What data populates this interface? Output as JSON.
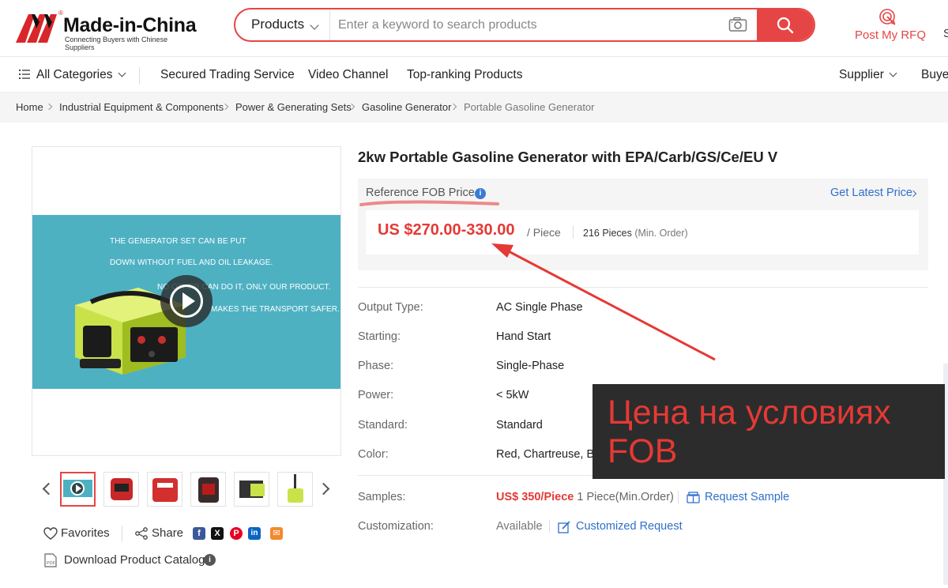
{
  "header": {
    "logo_name": "Made-in-China",
    "logo_registered": "®",
    "logo_tagline": "Connecting Buyers with Chinese Suppliers",
    "search_category": "Products",
    "search_placeholder": "Enter a keyword to search products",
    "rfq_label": "Post My RFQ",
    "cut_text": "S"
  },
  "nav": {
    "all_categories": "All Categories",
    "items": [
      "Secured Trading Service",
      "Video Channel",
      "Top-ranking Products"
    ],
    "supplier": "Supplier",
    "buyer": "Buyer"
  },
  "breadcrumb": [
    "Home",
    "Industrial Equipment & Components",
    "Power & Generating Sets",
    "Gasoline Generator",
    "Portable Gasoline Generator"
  ],
  "hero_text": [
    "THE GENERATOR SET CAN BE PUT",
    "DOWN WITHOUT FUEL AND OIL LEAKAGE.",
    "NO OTHER CAN DO IT, ONLY OUR PRODUCT.",
    "MAKES THE TRANSPORT SAFER."
  ],
  "actions": {
    "favorites": "Favorites",
    "share": "Share",
    "download": "Download Product Catalog",
    "social": [
      {
        "name": "facebook-icon",
        "glyph": "f",
        "color": "#3b5998"
      },
      {
        "name": "x-icon",
        "glyph": "X",
        "color": "#111111"
      },
      {
        "name": "pinterest-icon",
        "glyph": "P",
        "color": "#e60023"
      },
      {
        "name": "linkedin-icon",
        "glyph": "in",
        "color": "#0a66c2"
      },
      {
        "name": "email-icon",
        "glyph": "✉",
        "color": "#f28a2e"
      }
    ]
  },
  "product": {
    "title": "2kw Portable Gasoline Generator with EPA/Carb/GS/Ce/EU V",
    "price_label": "Reference FOB Price",
    "latest_price": "Get Latest Price",
    "price": "US $270.00-330.00",
    "unit": "/ Piece",
    "moq_value": "216 Pieces",
    "moq_label": "(Min. Order)"
  },
  "attributes": [
    {
      "key": "Output Type:",
      "value": "AC Single Phase"
    },
    {
      "key": "Starting:",
      "value": "Hand Start"
    },
    {
      "key": "Phase:",
      "value": "Single-Phase"
    },
    {
      "key": "Power:",
      "value": " < 5kW"
    },
    {
      "key": "Standard:",
      "value": "Standard"
    },
    {
      "key": "Color:",
      "value": "Red, Chartreuse, Blue"
    }
  ],
  "samples": {
    "key": "Samples:",
    "price": "US$ 350/Piece",
    "qty": "1 Piece(Min.Order)",
    "request": "Request Sample"
  },
  "customization": {
    "key": "Customization:",
    "value": "Available",
    "request": "Customized Request"
  },
  "annotation": {
    "text": "Цена на условиях FOB"
  },
  "colors": {
    "brand_red": "#e64545",
    "price_red": "#e53935",
    "link_blue": "#2f6fc9",
    "hero_teal": "#4eb1c2"
  }
}
